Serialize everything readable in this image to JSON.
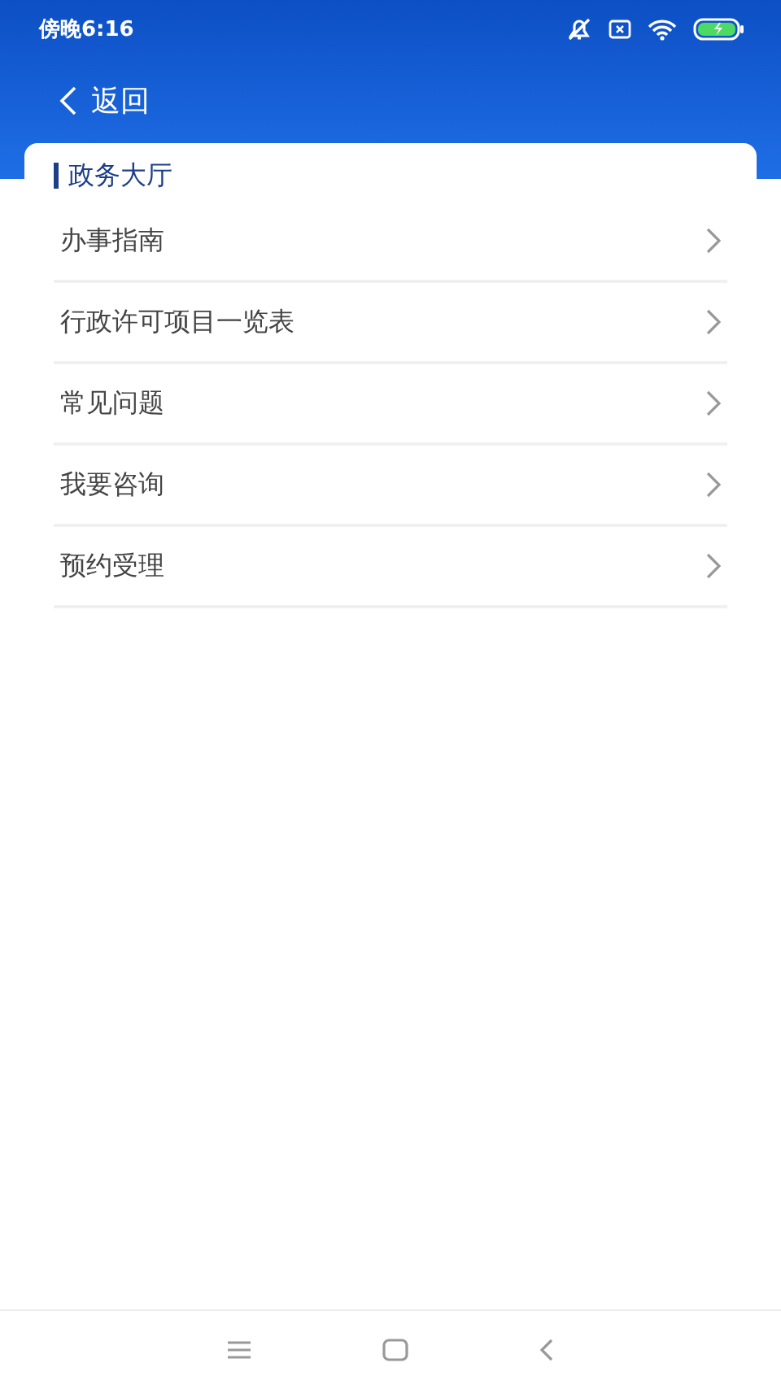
{
  "status_bar": {
    "time": "傍晚6:16"
  },
  "header": {
    "back_label": "返回"
  },
  "section": {
    "title": "政务大厅",
    "items": [
      {
        "label": "办事指南"
      },
      {
        "label": "行政许可项目一览表"
      },
      {
        "label": "常见问题"
      },
      {
        "label": "我要咨询"
      },
      {
        "label": "预约受理"
      }
    ]
  }
}
